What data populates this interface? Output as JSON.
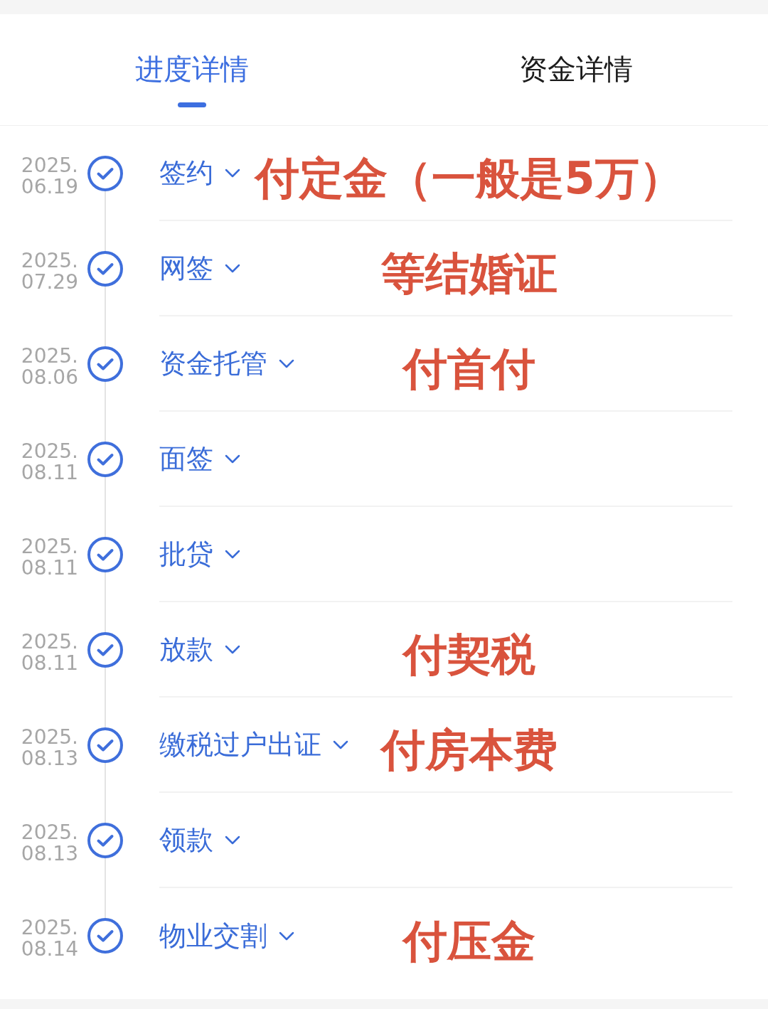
{
  "tabs": [
    {
      "label": "进度详情",
      "selected": true
    },
    {
      "label": "资金详情",
      "selected": false
    }
  ],
  "steps": [
    {
      "date": [
        "2025.",
        "06.19"
      ],
      "done": true,
      "title": "签约",
      "note": "付定金（一般是5万）"
    },
    {
      "date": [
        "2025.",
        "07.29"
      ],
      "done": true,
      "title": "网签",
      "note": "等结婚证"
    },
    {
      "date": [
        "2025.",
        "08.06"
      ],
      "done": true,
      "title": "资金托管",
      "note": "付首付"
    },
    {
      "date": [
        "2025.",
        "08.11"
      ],
      "done": true,
      "title": "面签"
    },
    {
      "date": [
        "2025.",
        "08.11"
      ],
      "done": true,
      "title": "批贷"
    },
    {
      "date": [
        "2025.",
        "08.11"
      ],
      "done": true,
      "title": "放款",
      "note": "付契税"
    },
    {
      "date": [
        "2025.",
        "08.13"
      ],
      "done": true,
      "title": "缴税过户出证",
      "note": "付房本费"
    },
    {
      "date": [
        "2025.",
        "08.13"
      ],
      "done": true,
      "title": "领款"
    },
    {
      "date": [
        "2025.",
        "08.14"
      ],
      "done": true,
      "title": "物业交割",
      "note": "付压金"
    }
  ]
}
